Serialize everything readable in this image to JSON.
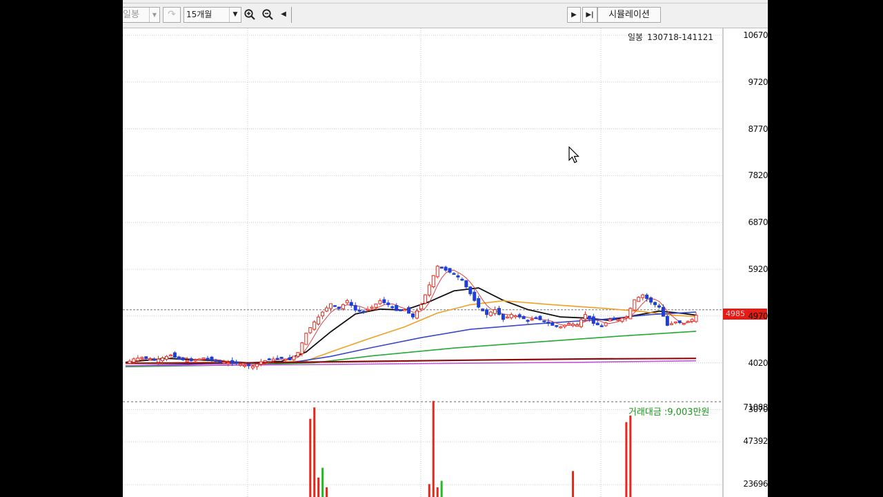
{
  "toolbar": {
    "period_value": "일봉",
    "range_value": "15개월",
    "simulation_label": "시뮬레이션",
    "icons": [
      "chevron-down-icon",
      "redo-icon",
      "zoom-in-icon",
      "zoom-out-icon",
      "chevron-left-icon",
      "play-icon",
      "skip-end-icon"
    ]
  },
  "chart_info": {
    "period_label": "일봉",
    "date_range": "130718-141121"
  },
  "volume_info": {
    "label": "거래대금 :9,003만원"
  },
  "current_price": "4985",
  "colors": {
    "up": "#e8271b",
    "down": "#1f3fd6",
    "ma_short": "#d94040",
    "ma_black": "#101010",
    "ma_orange": "#f0a020",
    "ma_blue": "#3a46c8",
    "ma_green": "#22aa33",
    "ma_darkred": "#8a0c0c",
    "ma_purple": "#c058d8",
    "price_badge": "#e41c14",
    "volume_up": "#e8271b",
    "volume_down": "#22bb22"
  },
  "chart_data": {
    "type": "candlestick",
    "period": "일봉",
    "date_range": "130718-141121",
    "y_ticks": [
      10670,
      9720,
      8770,
      7820,
      6870,
      5920,
      4970,
      4020,
      3070
    ],
    "ylim": [
      3070,
      10670
    ],
    "current_price": 4985,
    "close_path": [
      {
        "i": 0,
        "v": 4010
      },
      {
        "i": 2,
        "v": 4100
      },
      {
        "i": 4,
        "v": 4130
      },
      {
        "i": 7,
        "v": 4070
      },
      {
        "i": 9,
        "v": 4120
      },
      {
        "i": 11,
        "v": 4180
      },
      {
        "i": 13,
        "v": 4090
      },
      {
        "i": 16,
        "v": 4060
      },
      {
        "i": 19,
        "v": 4120
      },
      {
        "i": 21,
        "v": 4070
      },
      {
        "i": 24,
        "v": 4030
      },
      {
        "i": 27,
        "v": 4010
      },
      {
        "i": 29,
        "v": 3970
      },
      {
        "i": 31,
        "v": 3950
      },
      {
        "i": 33,
        "v": 4040
      },
      {
        "i": 35,
        "v": 4090
      },
      {
        "i": 38,
        "v": 4110
      },
      {
        "i": 40,
        "v": 4080
      },
      {
        "i": 42,
        "v": 4230
      },
      {
        "i": 44,
        "v": 4620
      },
      {
        "i": 46,
        "v": 4850
      },
      {
        "i": 48,
        "v": 5050
      },
      {
        "i": 50,
        "v": 5220
      },
      {
        "i": 52,
        "v": 5120
      },
      {
        "i": 54,
        "v": 5280
      },
      {
        "i": 56,
        "v": 5090
      },
      {
        "i": 58,
        "v": 5060
      },
      {
        "i": 60,
        "v": 5150
      },
      {
        "i": 62,
        "v": 5280
      },
      {
        "i": 64,
        "v": 5200
      },
      {
        "i": 66,
        "v": 5080
      },
      {
        "i": 68,
        "v": 5100
      },
      {
        "i": 70,
        "v": 4950
      },
      {
        "i": 72,
        "v": 5200
      },
      {
        "i": 74,
        "v": 5600
      },
      {
        "i": 76,
        "v": 5980
      },
      {
        "i": 78,
        "v": 5900
      },
      {
        "i": 80,
        "v": 5820
      },
      {
        "i": 82,
        "v": 5700
      },
      {
        "i": 84,
        "v": 5420
      },
      {
        "i": 86,
        "v": 5150
      },
      {
        "i": 88,
        "v": 5000
      },
      {
        "i": 90,
        "v": 5100
      },
      {
        "i": 92,
        "v": 4900
      },
      {
        "i": 94,
        "v": 5000
      },
      {
        "i": 96,
        "v": 4950
      },
      {
        "i": 98,
        "v": 4880
      },
      {
        "i": 100,
        "v": 4930
      },
      {
        "i": 102,
        "v": 4860
      },
      {
        "i": 104,
        "v": 4780
      },
      {
        "i": 106,
        "v": 4750
      },
      {
        "i": 108,
        "v": 4820
      },
      {
        "i": 110,
        "v": 4790
      },
      {
        "i": 112,
        "v": 5000
      },
      {
        "i": 114,
        "v": 4820
      },
      {
        "i": 116,
        "v": 4760
      },
      {
        "i": 118,
        "v": 4900
      },
      {
        "i": 120,
        "v": 4900
      },
      {
        "i": 122,
        "v": 4950
      },
      {
        "i": 124,
        "v": 5300
      },
      {
        "i": 126,
        "v": 5400
      },
      {
        "i": 128,
        "v": 5250
      },
      {
        "i": 130,
        "v": 5150
      },
      {
        "i": 132,
        "v": 4780
      },
      {
        "i": 134,
        "v": 4850
      },
      {
        "i": 136,
        "v": 4820
      },
      {
        "i": 138,
        "v": 4900
      },
      {
        "i": 139,
        "v": 4985
      }
    ],
    "ma_lines": [
      {
        "color_key": "ma_black",
        "points": [
          [
            0,
            4030
          ],
          [
            10,
            4110
          ],
          [
            20,
            4070
          ],
          [
            30,
            4020
          ],
          [
            38,
            4050
          ],
          [
            44,
            4240
          ],
          [
            50,
            4650
          ],
          [
            56,
            5010
          ],
          [
            62,
            5110
          ],
          [
            68,
            5090
          ],
          [
            74,
            5260
          ],
          [
            80,
            5480
          ],
          [
            86,
            5540
          ],
          [
            92,
            5290
          ],
          [
            98,
            5100
          ],
          [
            106,
            4950
          ],
          [
            112,
            4930
          ],
          [
            118,
            4880
          ],
          [
            124,
            4980
          ],
          [
            130,
            5070
          ],
          [
            136,
            5020
          ],
          [
            139,
            4985
          ]
        ]
      },
      {
        "color_key": "ma_orange",
        "points": [
          [
            0,
            4010
          ],
          [
            20,
            4030
          ],
          [
            36,
            4020
          ],
          [
            44,
            4060
          ],
          [
            52,
            4300
          ],
          [
            60,
            4530
          ],
          [
            68,
            4750
          ],
          [
            76,
            5030
          ],
          [
            84,
            5200
          ],
          [
            92,
            5280
          ],
          [
            104,
            5200
          ],
          [
            116,
            5130
          ],
          [
            126,
            5060
          ],
          [
            134,
            4980
          ],
          [
            139,
            4960
          ]
        ]
      },
      {
        "color_key": "ma_blue",
        "points": [
          [
            0,
            3960
          ],
          [
            20,
            4000
          ],
          [
            40,
            4020
          ],
          [
            50,
            4150
          ],
          [
            60,
            4330
          ],
          [
            72,
            4530
          ],
          [
            84,
            4700
          ],
          [
            100,
            4810
          ],
          [
            116,
            4900
          ],
          [
            128,
            5000
          ],
          [
            139,
            5050
          ]
        ]
      },
      {
        "color_key": "ma_green",
        "points": [
          [
            0,
            3940
          ],
          [
            30,
            3980
          ],
          [
            46,
            4020
          ],
          [
            60,
            4160
          ],
          [
            80,
            4320
          ],
          [
            100,
            4440
          ],
          [
            120,
            4560
          ],
          [
            139,
            4660
          ]
        ]
      },
      {
        "color_key": "ma_darkred",
        "points": [
          [
            0,
            4010
          ],
          [
            30,
            4020
          ],
          [
            60,
            4050
          ],
          [
            90,
            4080
          ],
          [
            115,
            4100
          ],
          [
            139,
            4110
          ]
        ]
      },
      {
        "color_key": "ma_purple",
        "points": [
          [
            0,
            3960
          ],
          [
            40,
            3980
          ],
          [
            80,
            4010
          ],
          [
            110,
            4030
          ],
          [
            139,
            4060
          ]
        ]
      }
    ],
    "volume_ticks": [
      71088,
      47392,
      23696
    ],
    "volume_bars": [
      {
        "i": 2,
        "v": 4200,
        "up": true
      },
      {
        "i": 44,
        "v": 11000,
        "up": true
      },
      {
        "i": 45,
        "v": 64000,
        "up": true
      },
      {
        "i": 46,
        "v": 71000,
        "up": true
      },
      {
        "i": 47,
        "v": 28000,
        "up": true
      },
      {
        "i": 48,
        "v": 34000,
        "up": false
      },
      {
        "i": 49,
        "v": 22000,
        "up": true
      },
      {
        "i": 50,
        "v": 16000,
        "up": true
      },
      {
        "i": 73,
        "v": 14000,
        "up": true
      },
      {
        "i": 74,
        "v": 24000,
        "up": true
      },
      {
        "i": 75,
        "v": 75000,
        "up": true
      },
      {
        "i": 76,
        "v": 22000,
        "up": true
      },
      {
        "i": 77,
        "v": 26000,
        "up": false
      },
      {
        "i": 78,
        "v": 9000,
        "up": false
      },
      {
        "i": 105,
        "v": 4000,
        "up": true
      },
      {
        "i": 106,
        "v": 3500,
        "up": false
      },
      {
        "i": 109,
        "v": 32000,
        "up": true
      },
      {
        "i": 111,
        "v": 9000,
        "up": false
      },
      {
        "i": 112,
        "v": 5500,
        "up": true
      },
      {
        "i": 113,
        "v": 4500,
        "up": false
      },
      {
        "i": 115,
        "v": 6000,
        "up": true
      },
      {
        "i": 120,
        "v": 6500,
        "up": true
      },
      {
        "i": 121,
        "v": 15000,
        "up": true
      },
      {
        "i": 122,
        "v": 62000,
        "up": true
      },
      {
        "i": 123,
        "v": 66000,
        "up": true
      },
      {
        "i": 124,
        "v": 8000,
        "up": false
      }
    ]
  }
}
